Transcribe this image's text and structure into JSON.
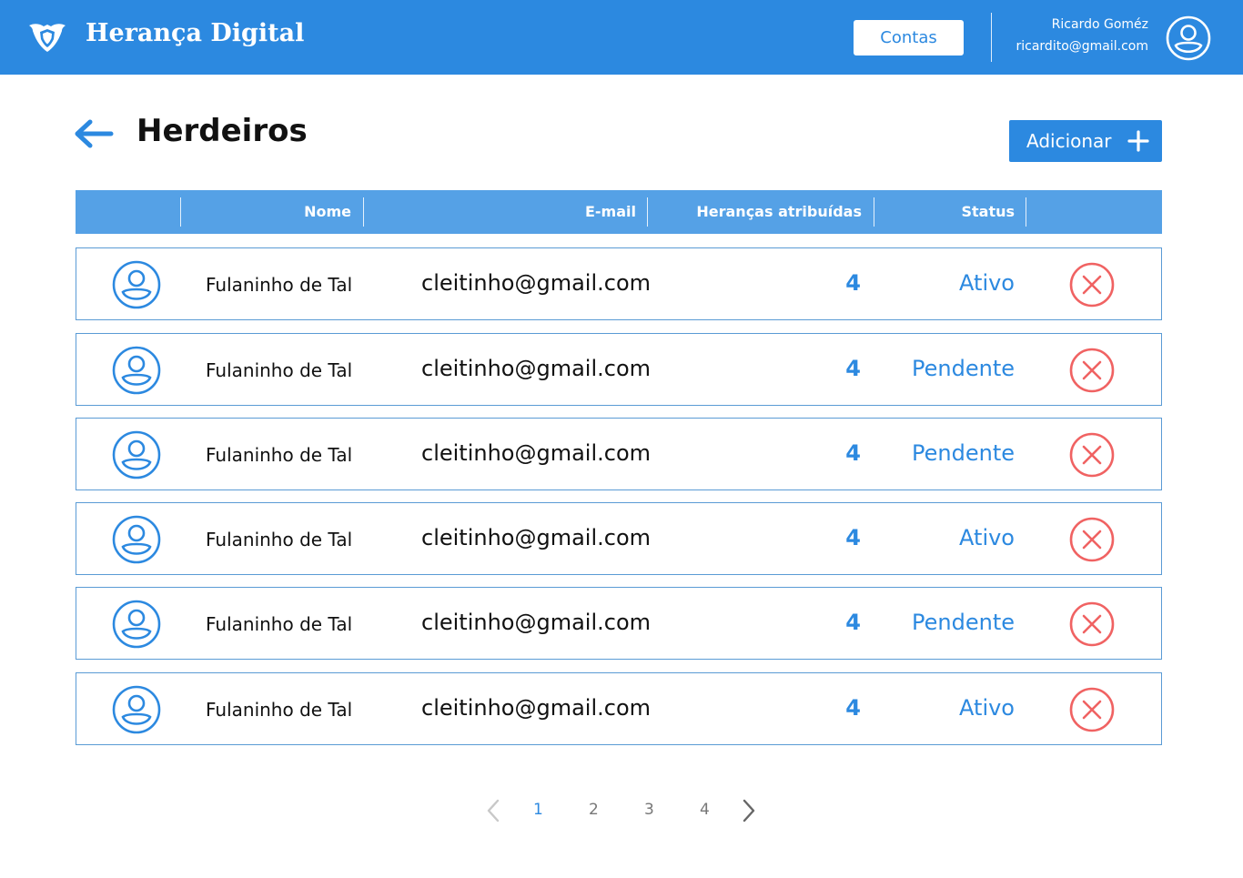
{
  "header": {
    "brand": "Herança Digital",
    "contas_label": "Contas",
    "user_name": "Ricardo Goméz",
    "user_email": "ricardito@gmail.com"
  },
  "page": {
    "title": "Herdeiros",
    "add_label": "Adicionar"
  },
  "table": {
    "columns": [
      "Nome",
      "E-mail",
      "Heranças atribuídas",
      "Status"
    ],
    "rows": [
      {
        "name": "Fulaninho de Tal",
        "email": "cleitinho@gmail.com",
        "count": "4",
        "status": "Ativo"
      },
      {
        "name": "Fulaninho de Tal",
        "email": "cleitinho@gmail.com",
        "count": "4",
        "status": "Pendente"
      },
      {
        "name": "Fulaninho de Tal",
        "email": "cleitinho@gmail.com",
        "count": "4",
        "status": "Pendente"
      },
      {
        "name": "Fulaninho de Tal",
        "email": "cleitinho@gmail.com",
        "count": "4",
        "status": "Ativo"
      },
      {
        "name": "Fulaninho de Tal",
        "email": "cleitinho@gmail.com",
        "count": "4",
        "status": "Pendente"
      },
      {
        "name": "Fulaninho de Tal",
        "email": "cleitinho@gmail.com",
        "count": "4",
        "status": "Ativo"
      }
    ]
  },
  "pagination": {
    "pages": [
      "1",
      "2",
      "3",
      "4"
    ],
    "current": "1"
  },
  "icons": {
    "logo": "shield-wings-icon",
    "user": "user-circle-icon",
    "back": "arrow-left-icon",
    "add": "plus-icon",
    "remove": "close-circle-icon",
    "prev": "chevron-left-icon",
    "next": "chevron-right-icon"
  },
  "colors": {
    "primary": "#2C89E0",
    "header_row": "#55A1E6",
    "danger": "#F06262"
  }
}
